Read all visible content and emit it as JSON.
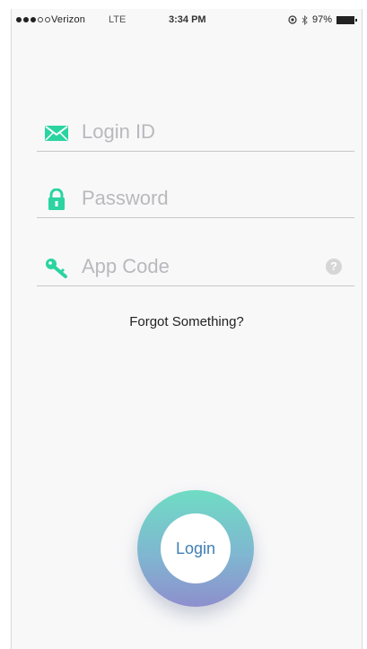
{
  "status_bar": {
    "signal_filled": 3,
    "signal_total": 5,
    "carrier": "Verizon",
    "network": "LTE",
    "time": "3:34 PM",
    "battery": "97%"
  },
  "form": {
    "login_id": {
      "value": "",
      "placeholder": "Login ID",
      "icon": "envelope-icon"
    },
    "password": {
      "value": "",
      "placeholder": "Password",
      "icon": "lock-icon"
    },
    "app_code": {
      "value": "",
      "placeholder": "App Code",
      "icon": "key-icon",
      "help": "?"
    }
  },
  "forgot_label": "Forgot Something?",
  "login_label": "Login",
  "colors": {
    "accent_green": "#2bd4a0",
    "ring_top": "#6fdcc4",
    "ring_bottom": "#8e8fce",
    "login_text": "#3f7fb4"
  }
}
